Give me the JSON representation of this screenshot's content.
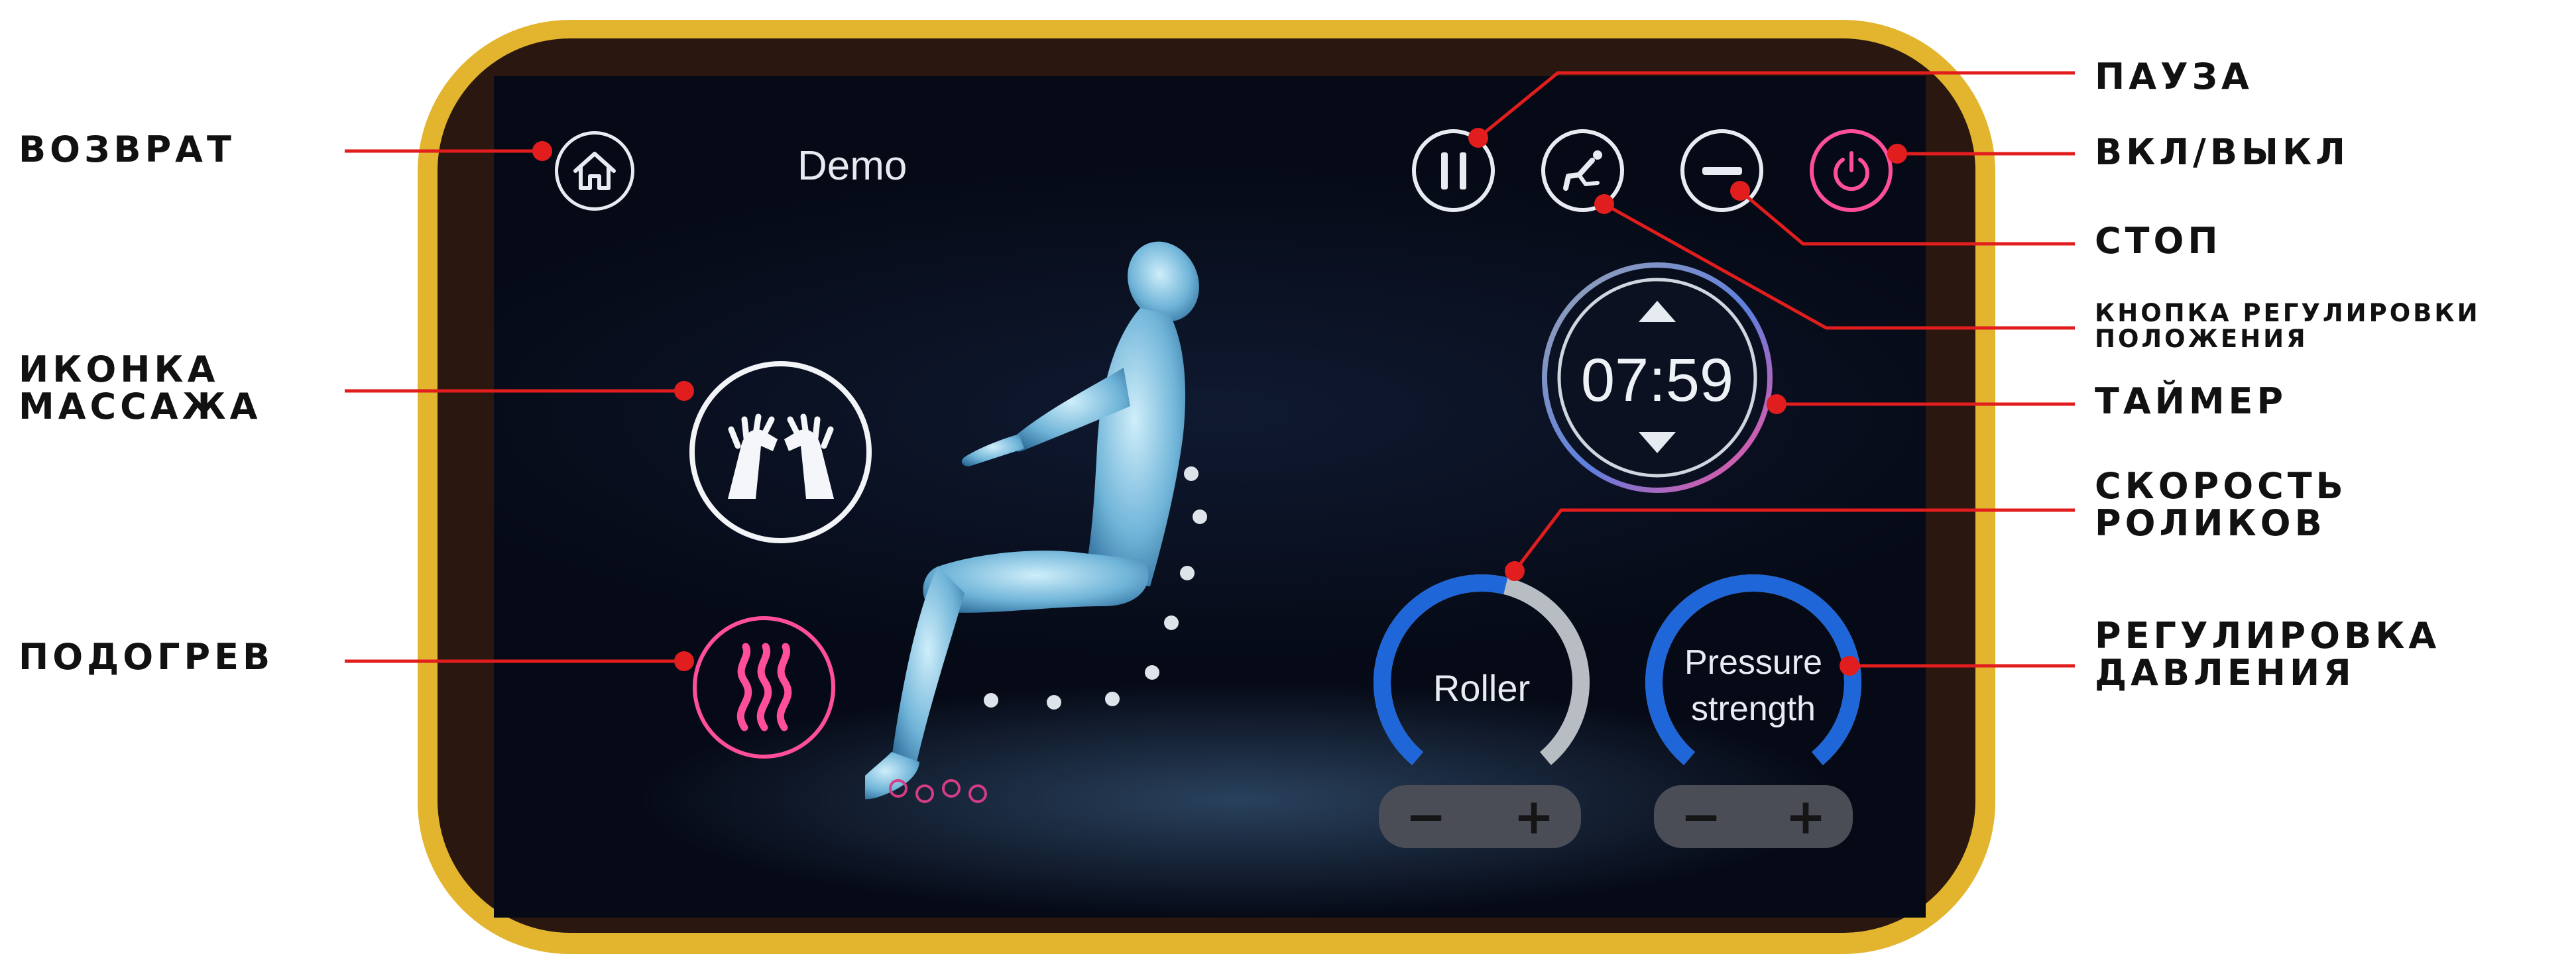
{
  "screen": {
    "title": "Demo",
    "timer": "07:59",
    "roller_label": "Roller",
    "pressure_label_line1": "Pressure",
    "pressure_label_line2": "strength",
    "minus": "−",
    "plus": "+"
  },
  "callouts": {
    "return": "ВОЗВРАТ",
    "massage_icon_line1": "ИКОНКА",
    "massage_icon_line2": "МАССАЖА",
    "heating": "ПОДОГРЕВ",
    "pause": "ПАУЗА",
    "on_off": "ВКЛ/ВЫКЛ",
    "stop": "СТОП",
    "position_button_line1": "КНОПКА РЕГУЛИРОВКИ",
    "position_button_line2": "ПОЛОЖЕНИЯ",
    "timer": "ТАЙМЕР",
    "roller_speed_line1": "СКОРОСТЬ",
    "roller_speed_line2": "РОЛИКОВ",
    "pressure_adjust_line1": "РЕГУЛИРОВКА",
    "pressure_adjust_line2": "ДАВЛЕНИЯ"
  },
  "colors": {
    "frame": "#e3b52f",
    "callout_line": "#e11d1d",
    "accent_pink": "#ff4f9a",
    "gauge_blue": "#1f66d8",
    "gauge_gray": "#b8bcc3"
  },
  "gauges": {
    "roller_level": 0.55,
    "pressure_level": 1.0
  },
  "icons": [
    "home-icon",
    "massage-hands-icon",
    "heat-icon",
    "pause-icon",
    "recline-icon",
    "stop-icon",
    "power-icon",
    "arrow-up-icon",
    "arrow-down-icon",
    "foot-massage-icon"
  ]
}
